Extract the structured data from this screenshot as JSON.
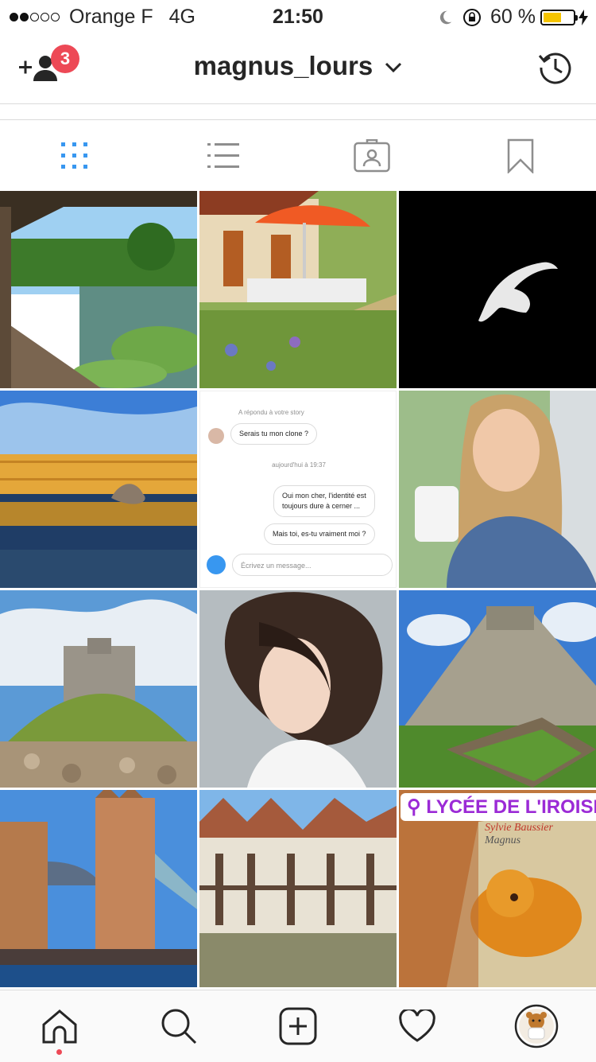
{
  "status_bar": {
    "carrier": "Orange F",
    "network": "4G",
    "time": "21:50",
    "battery_text": "60 %",
    "battery_level": 0.6,
    "signal_bars_filled": 2,
    "signal_bars_total": 5
  },
  "header": {
    "username": "magnus_lours",
    "notification_count": "3",
    "icons": {
      "add_user": "add-user-icon",
      "history": "history-icon"
    }
  },
  "tabs": [
    {
      "name": "grid",
      "active": true
    },
    {
      "name": "list",
      "active": false
    },
    {
      "name": "tagged",
      "active": false
    },
    {
      "name": "saved",
      "active": false
    }
  ],
  "posts": [
    {
      "id": "pond",
      "desc": "river pond with lily pads"
    },
    {
      "id": "patio",
      "desc": "patio with orange umbrella"
    },
    {
      "id": "bird",
      "desc": "white bird on black"
    },
    {
      "id": "palace",
      "desc": "palace reflected in water"
    },
    {
      "id": "chat",
      "desc": "story reply screenshot"
    },
    {
      "id": "girl",
      "desc": "girl with mug"
    },
    {
      "id": "castle",
      "desc": "castle on a hill"
    },
    {
      "id": "drawing",
      "desc": "digital portrait"
    },
    {
      "id": "pyramid",
      "desc": "stepped pyramid"
    },
    {
      "id": "bridge",
      "desc": "tower bridge"
    },
    {
      "id": "town",
      "desc": "half-timbered houses"
    },
    {
      "id": "bear",
      "desc": "book with teddy bear"
    }
  ],
  "chat_post": {
    "reply_label": "A répondu à votre story",
    "msg1": "Serais tu mon clone ?",
    "timestamp": "aujourd'hui à 19:37",
    "msg2_line1": "Oui mon cher, l'identité est",
    "msg2_line2": "toujours dure à cerner ...",
    "msg3": "Mais toi, es-tu vraiment moi ?",
    "input_placeholder": "Écrivez un message..."
  },
  "location_post": {
    "location": "LYCÉE DE L'IROISE",
    "book_author": "Sylvie Baussier",
    "book_title": "Magnus"
  },
  "bottom_nav": [
    {
      "name": "home",
      "active": true
    },
    {
      "name": "search",
      "active": false
    },
    {
      "name": "new-post",
      "active": false
    },
    {
      "name": "activity",
      "active": false
    },
    {
      "name": "profile",
      "active": false
    }
  ],
  "colors": {
    "accent": "#3897f0",
    "badge": "#ed4956",
    "battery": "#f5c400",
    "divider": "#dbdbdb"
  }
}
